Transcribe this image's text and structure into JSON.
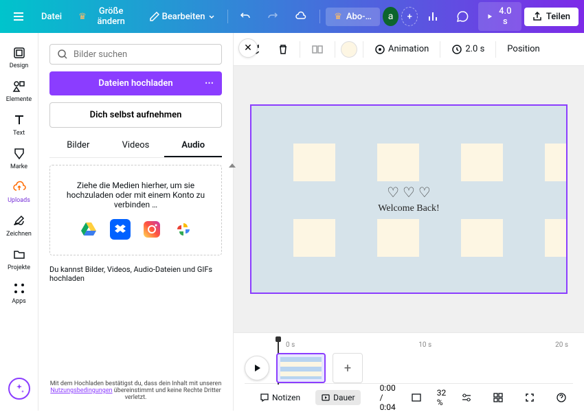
{
  "topbar": {
    "file": "Datei",
    "resize": "Größe ändern",
    "edit": "Bearbeiten",
    "pro": "Abo-…",
    "avatar": "a",
    "duration": "4.0 s",
    "share": "Teilen"
  },
  "leftsidebar": [
    {
      "label": "Design"
    },
    {
      "label": "Elemente"
    },
    {
      "label": "Text"
    },
    {
      "label": "Marke"
    },
    {
      "label": "Uploads"
    },
    {
      "label": "Zeichnen"
    },
    {
      "label": "Projekte"
    },
    {
      "label": "Apps"
    }
  ],
  "panel": {
    "search_placeholder": "Bilder suchen",
    "upload_btn": "Dateien hochladen",
    "record_btn": "Dich selbst aufnehmen",
    "tabs": [
      "Bilder",
      "Videos",
      "Audio"
    ],
    "dropzone": "Ziehe die Medien hierher, um sie hochzuladen oder mit einem Konto zu verbinden …",
    "hint": "Du kannst Bilder, Videos, Audio-Dateien und GIFs hochladen",
    "footer_pre": "Mit dem Hochladen bestätigst du, dass dein Inhalt mit unseren ",
    "footer_link": "Nutzungsbedingungen",
    "footer_post": " übereinstimmt und keine Rechte Dritter verletzt."
  },
  "canvas_toolbar": {
    "animation": "Animation",
    "page_duration": "2.0 s",
    "position": "Position"
  },
  "canvas": {
    "welcome": "Welcome Back!"
  },
  "timeline": {
    "marks": [
      "0 s",
      "10 s",
      "20 s"
    ]
  },
  "bottombar": {
    "notes": "Notizen",
    "duration": "Dauer",
    "time": "0:00 / 0:04",
    "zoom": "32 %"
  }
}
